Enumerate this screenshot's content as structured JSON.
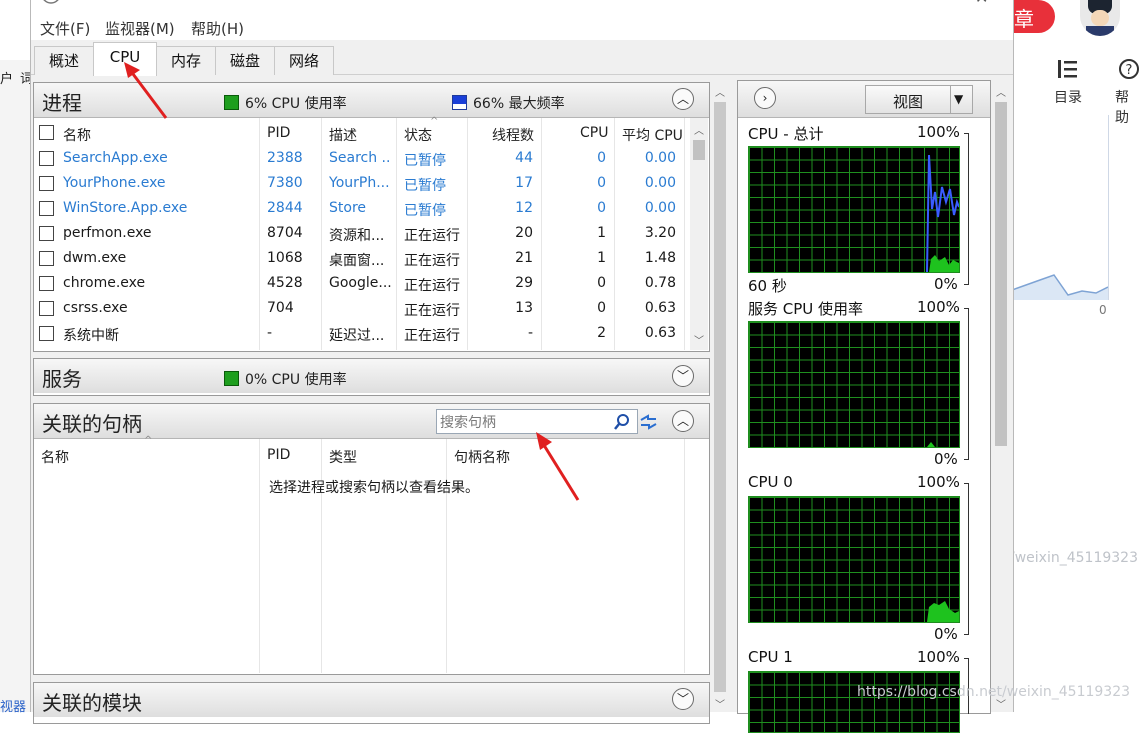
{
  "window": {
    "menus": [
      "文件(F)",
      "监视器(M)",
      "帮助(H)"
    ],
    "tabs": [
      "概述",
      "CPU",
      "内存",
      "磁盘",
      "网络"
    ],
    "active_tab": "CPU"
  },
  "processes": {
    "title": "进程",
    "cpu_usage": "6% CPU 使用率",
    "max_freq": "66% 最大频率",
    "columns": [
      "名称",
      "PID",
      "描述",
      "状态",
      "线程数",
      "CPU",
      "平均 CPU"
    ],
    "rows": [
      {
        "name": "SearchApp.exe",
        "pid": "2388",
        "desc": "Search ...",
        "status": "已暂停",
        "threads": "44",
        "cpu": "0",
        "avg": "0.00",
        "suspended": true
      },
      {
        "name": "YourPhone.exe",
        "pid": "7380",
        "desc": "YourPh...",
        "status": "已暂停",
        "threads": "17",
        "cpu": "0",
        "avg": "0.00",
        "suspended": true
      },
      {
        "name": "WinStore.App.exe",
        "pid": "2844",
        "desc": "Store",
        "status": "已暂停",
        "threads": "12",
        "cpu": "0",
        "avg": "0.00",
        "suspended": true
      },
      {
        "name": "perfmon.exe",
        "pid": "8704",
        "desc": "资源和...",
        "status": "正在运行",
        "threads": "20",
        "cpu": "1",
        "avg": "3.20",
        "suspended": false
      },
      {
        "name": "dwm.exe",
        "pid": "1068",
        "desc": "桌面窗...",
        "status": "正在运行",
        "threads": "21",
        "cpu": "1",
        "avg": "1.48",
        "suspended": false
      },
      {
        "name": "chrome.exe",
        "pid": "4528",
        "desc": "Google...",
        "status": "正在运行",
        "threads": "29",
        "cpu": "0",
        "avg": "0.78",
        "suspended": false
      },
      {
        "name": "csrss.exe",
        "pid": "704",
        "desc": "",
        "status": "正在运行",
        "threads": "13",
        "cpu": "0",
        "avg": "0.63",
        "suspended": false
      },
      {
        "name": "系统中断",
        "pid": "-",
        "desc": "延迟过...",
        "status": "正在运行",
        "threads": "-",
        "cpu": "2",
        "avg": "0.63",
        "suspended": false
      }
    ]
  },
  "services": {
    "title": "服务",
    "cpu_usage": "0% CPU 使用率"
  },
  "handles": {
    "title": "关联的句柄",
    "search_placeholder": "搜索句柄",
    "columns": [
      "名称",
      "PID",
      "类型",
      "句柄名称"
    ],
    "empty_message": "选择进程或搜索句柄以查看结果。"
  },
  "modules": {
    "title": "关联的模块"
  },
  "graphs": {
    "view_button": "视图",
    "items": [
      {
        "title": "CPU - 总计",
        "top": "100%",
        "bottom_left": "60 秒",
        "bottom_right": "0%"
      },
      {
        "title": "服务 CPU 使用率",
        "top": "100%",
        "bottom_left": "",
        "bottom_right": "0%"
      },
      {
        "title": "CPU 0",
        "top": "100%",
        "bottom_left": "",
        "bottom_right": "0%"
      },
      {
        "title": "CPU 1",
        "top": "100%",
        "bottom_left": "",
        "bottom_right": ""
      }
    ]
  },
  "background_page": {
    "badge": "章",
    "toc_label": "目录",
    "help_label": "帮助",
    "axis_zero": "0",
    "left_snippet_1": "户",
    "left_snippet_2": "词",
    "left_bottom": "视器",
    "watermark_1": "/weixin_45119323",
    "watermark_2": "https://blog.csdn.net/weixin_45119323"
  }
}
